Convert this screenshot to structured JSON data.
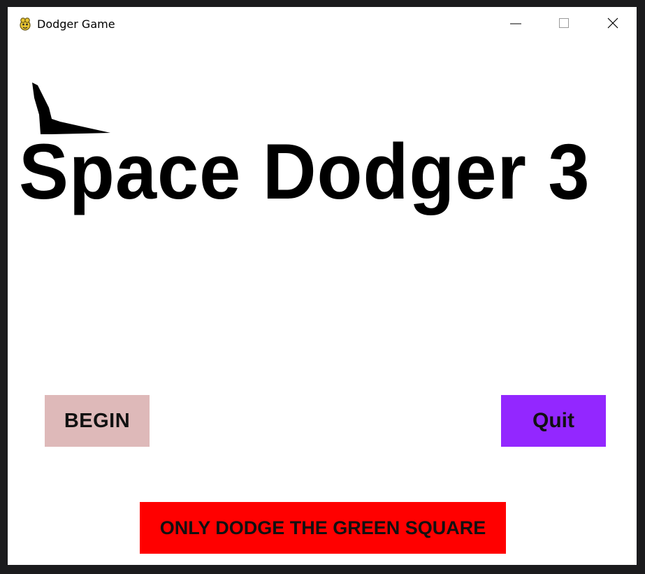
{
  "window": {
    "title": "Dodger Game",
    "icon": "pygame-snake-icon"
  },
  "game": {
    "title": "Space Dodger 3",
    "begin_label": "BEGIN",
    "quit_label": "Quit",
    "instruction": "ONLY DODGE THE GREEN SQUARE"
  },
  "colors": {
    "begin_button": "#deb9b9",
    "quit_button": "#9327ff",
    "instruction_banner": "#ff0000",
    "background": "#ffffff"
  }
}
